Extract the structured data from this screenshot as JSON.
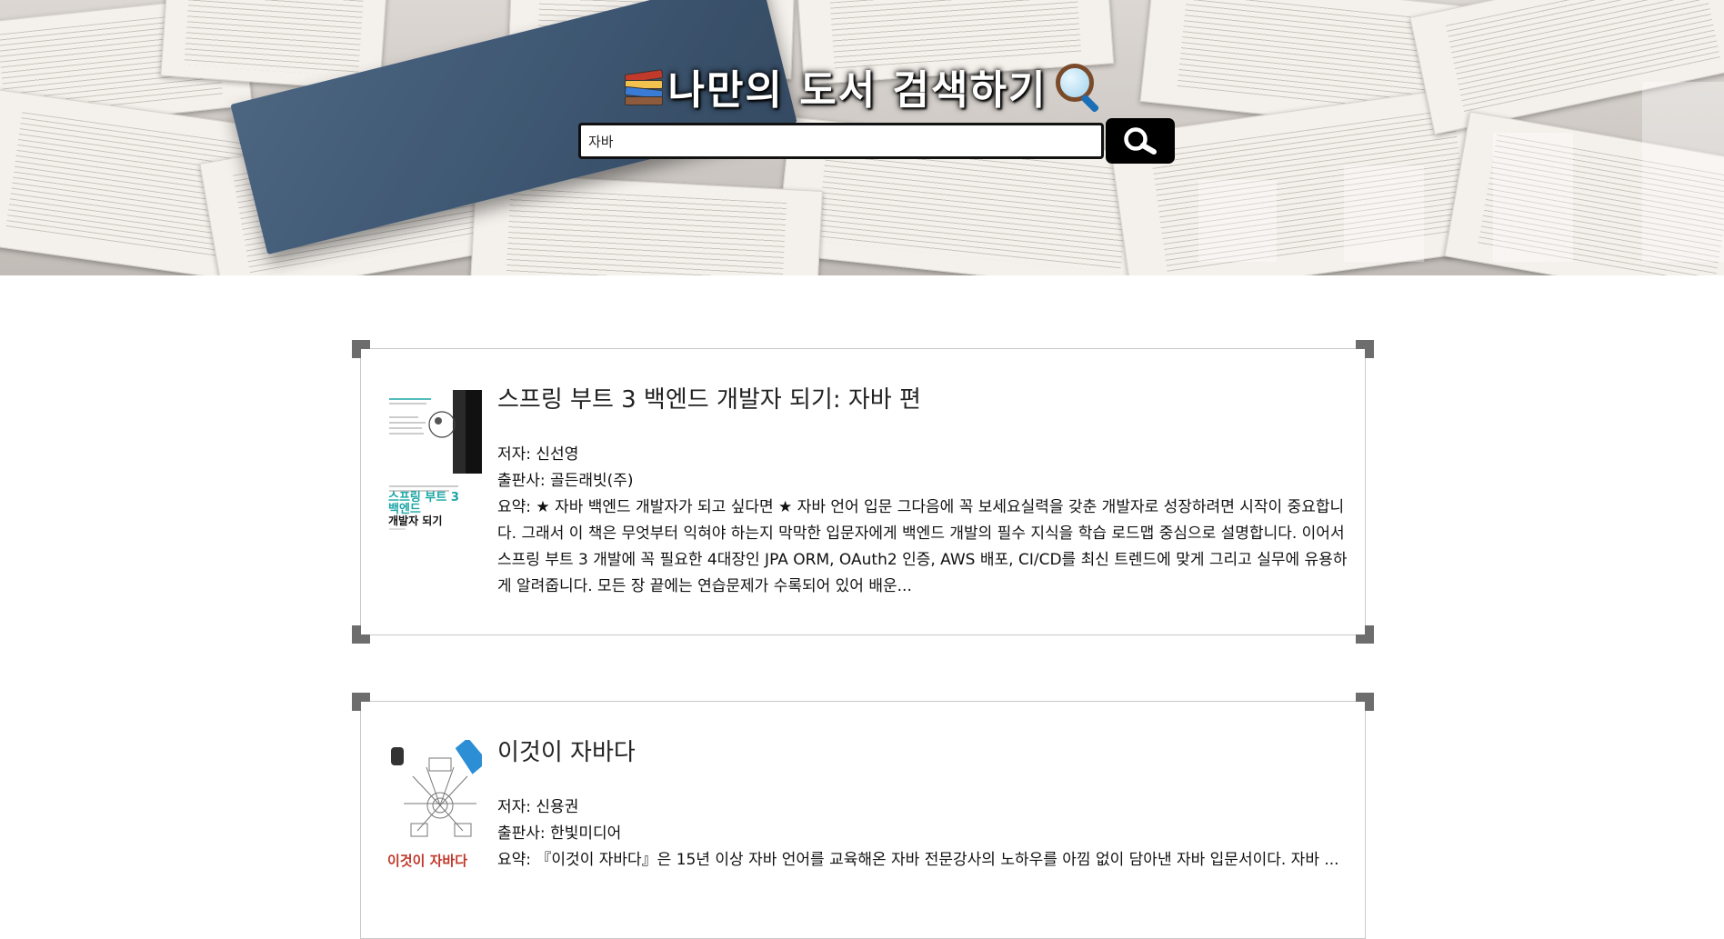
{
  "header": {
    "title": "나만의 도서 검색하기",
    "books_icon": "books-stack-icon",
    "magnifier_icon": "magnifying-glass-icon"
  },
  "search": {
    "value": "자바",
    "button_icon": "search-icon"
  },
  "results": [
    {
      "title": "스프링 부트 3 백엔드 개발자 되기: 자바 편",
      "author_label": "저자:",
      "author": "신선영",
      "publisher_label": "출판사:",
      "publisher": "골든래빗(주)",
      "summary_label": "요약:",
      "summary": "★ 자바 백엔드 개발자가 되고 싶다면 ★ 자바 언어 입문 그다음에 꼭 보세요실력을 갖춘 개발자로 성장하려면 시작이 중요합니다. 그래서 이 책은 무엇부터 익혀야 하는지 막막한 입문자에게 백엔드 개발의 필수 지식을 학습 로드맵 중심으로 설명합니다. 이어서 스프링 부트 3 개발에 꼭 필요한 4대장인 JPA ORM, OAuth2 인증, AWS 배포, CI/CD를 최신 트렌드에 맞게 그리고 실무에 유용하게 알려줍니다. 모든 장 끝에는 연습문제가 수록되어 있어 배운...",
      "cover": {
        "top_text": "스프링 부트 3",
        "mid_text": "백엔드",
        "bottom_text": "개발자 되기",
        "accent_color": "#1aa6a6"
      }
    },
    {
      "title": "이것이 자바다",
      "author_label": "저자:",
      "author": "신용권",
      "publisher_label": "출판사:",
      "publisher": "한빛미디어",
      "summary_label": "요약:",
      "summary": "『이것이 자바다』은 15년 이상 자바 언어를 교육해온 자바 전문강사의 노하우를 아낌 없이 담아낸 자바 입문서이다. 자바 ...",
      "cover": {
        "top_text": "이것이 자바다",
        "accent_color": "#2c8fd6"
      }
    }
  ],
  "colors": {
    "background": "#ffffff",
    "card_border": "#c9c9c9",
    "corner": "#6d6d6d",
    "search_button": "#000000"
  }
}
